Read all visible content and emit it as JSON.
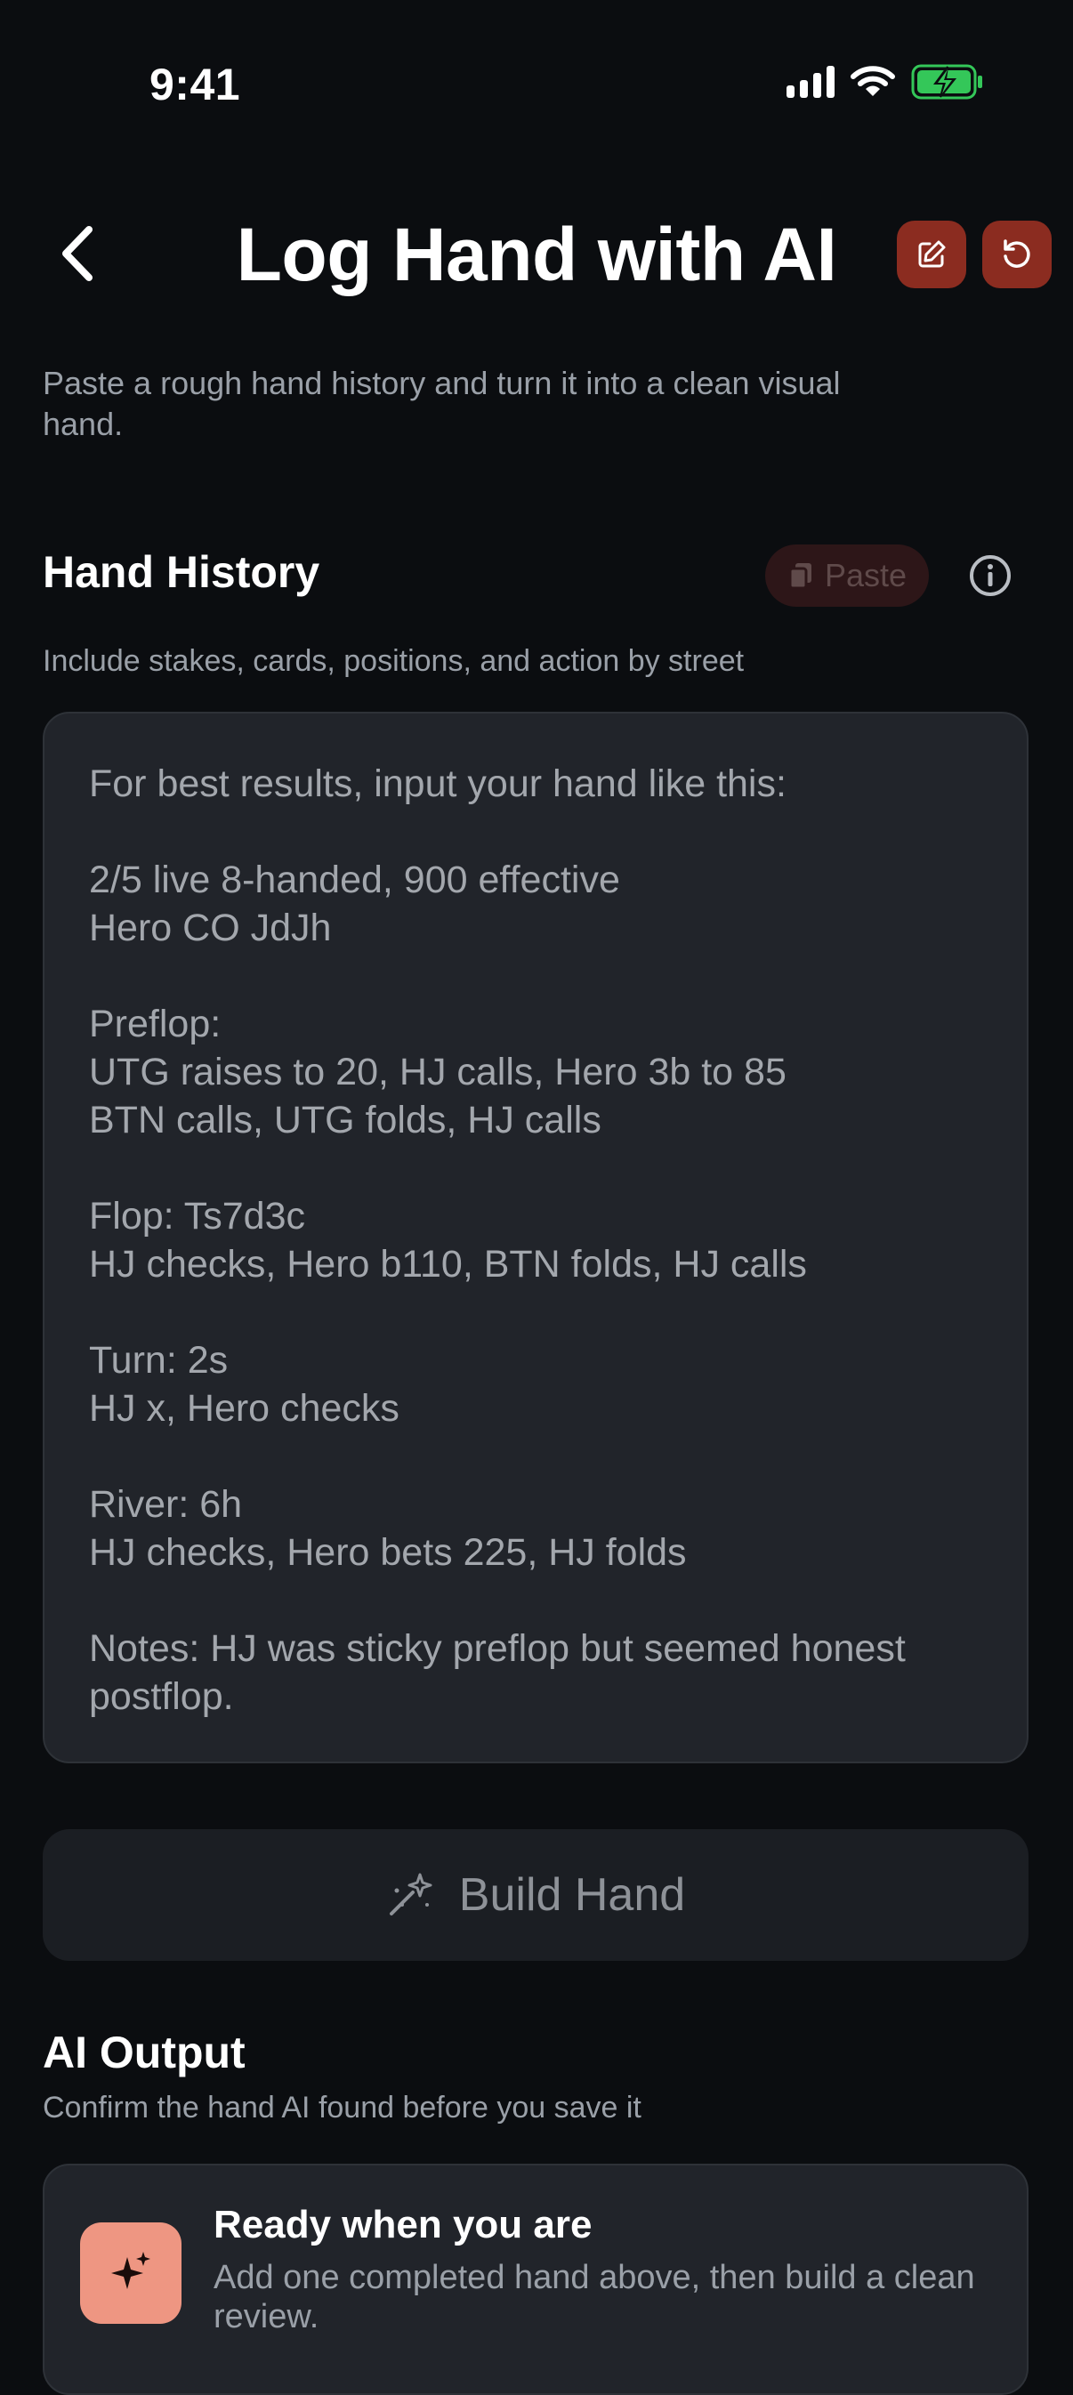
{
  "status_bar": {
    "time": "9:41",
    "icons": [
      "cellular-signal-icon",
      "wifi-icon",
      "battery-charging-icon"
    ]
  },
  "header": {
    "title": "Log Hand with AI",
    "icons": {
      "back": "chevron-left-icon",
      "edit": "edit-square-icon",
      "reset": "rotate-ccw-icon"
    },
    "colors": {
      "action_button_bg": "#8b2c20"
    }
  },
  "intro": {
    "subtitle": "Paste a rough hand history and turn it into a clean visual hand."
  },
  "hand_history": {
    "title": "Hand History",
    "paste_label": "Paste",
    "helper": "Include stakes, cards, positions, and action by street",
    "placeholder": "For best results, input your hand like this:\n\n2/5 live 8-handed, 900 effective\nHero CO JdJh\n\nPreflop:\nUTG raises to 20, HJ calls, Hero 3b to 85\nBTN calls, UTG folds, HJ calls\n\nFlop: Ts7d3c\nHJ checks, Hero b110, BTN folds, HJ calls\n\nTurn: 2s\nHJ x, Hero checks\n\nRiver: 6h\nHJ checks, Hero bets 225, HJ folds\n\nNotes: HJ was sticky preflop but seemed honest postflop.",
    "value": ""
  },
  "build_button": {
    "label": "Build Hand",
    "icon": "magic-wand-sparkle-icon"
  },
  "ai_output": {
    "title": "AI Output",
    "helper": "Confirm the hand AI found before you save it",
    "empty_state": {
      "title": "Ready when you are",
      "text": "Add one completed hand above, then build a clean review.",
      "icon": "sparkle-icon",
      "accent": "#ee9682"
    }
  }
}
